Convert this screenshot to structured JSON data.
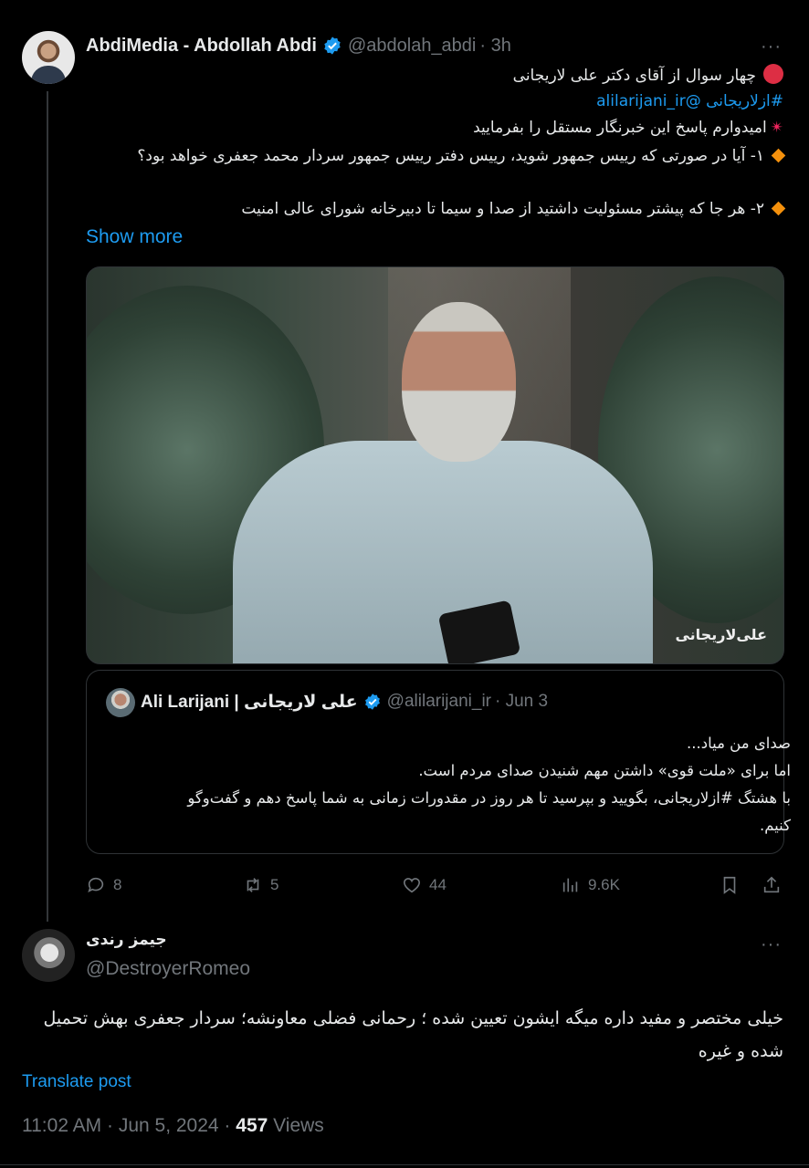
{
  "tweet": {
    "author_name": "AbdiMedia - Abdollah Abdi",
    "author_handle": "@abdolah_abdi",
    "time_ago": "· 3h",
    "more": "···",
    "lines": [
      "چهار سوال از آقای دکتر علی لاریجانی",
      "#ازلاریجانی @alilarijani_ir",
      "امیدوارم پاسخ این خبرنگار مستقل را بفرمایید",
      "۱- آیا در صورتی که رییس جمهور شوید، رییس دفتر رییس جمهور سردار محمد جعفری خواهد بود؟",
      "۲- هر جا که پیشتر مسئولیت داشتید از صدا و سیما تا دبیرخانه شورای عالی امنیت"
    ],
    "hashtag": "#ازلاریجانی",
    "mention": "@alilarijani_ir",
    "show_more": "Show more",
    "media_watermark": "علی‌لاریجانی",
    "quoted": {
      "author_name": "Ali Larijani | علی لاریجانی",
      "author_handle": "@alilarijani_ir",
      "date": "· Jun 3",
      "lines": [
        "صدای من میاد...",
        "اما برای «ملت قوی» داشتن مهم شنیدن صدای مردم است.",
        "با هشتگ #ازلاریجانی، بگویید و بپرسید تا هر روز در مقدورات زمانی به شما پاسخ دهم و گفت‌وگو",
        "کنیم."
      ]
    },
    "stats": {
      "replies": "8",
      "reposts": "5",
      "likes": "44",
      "views": "9.6K"
    }
  },
  "reply": {
    "author_name": "جیمز رندی",
    "author_handle": "@DestroyerRomeo",
    "more": "···",
    "lines": [
      "خیلی مختصر و مفید داره میگه ایشون تعیین شده ؛ رحمانی فضلی معاونشه؛ سردار جعفری بهش تحمیل",
      "شده و غیره"
    ],
    "translate": "Translate post",
    "time": "11:02 AM · Jun 5, 2024 ·",
    "views_count": "457",
    "views_label": "Views"
  },
  "colors": {
    "accent": "#1d9bf0",
    "muted": "#71767b",
    "text": "#e7e9ea",
    "background": "#000000"
  },
  "icons": [
    "verified-badge-icon",
    "reply-icon",
    "repost-icon",
    "like-icon",
    "views-icon",
    "bookmark-icon",
    "share-icon",
    "red-circle-icon",
    "diamond-icon",
    "anger-icon"
  ]
}
